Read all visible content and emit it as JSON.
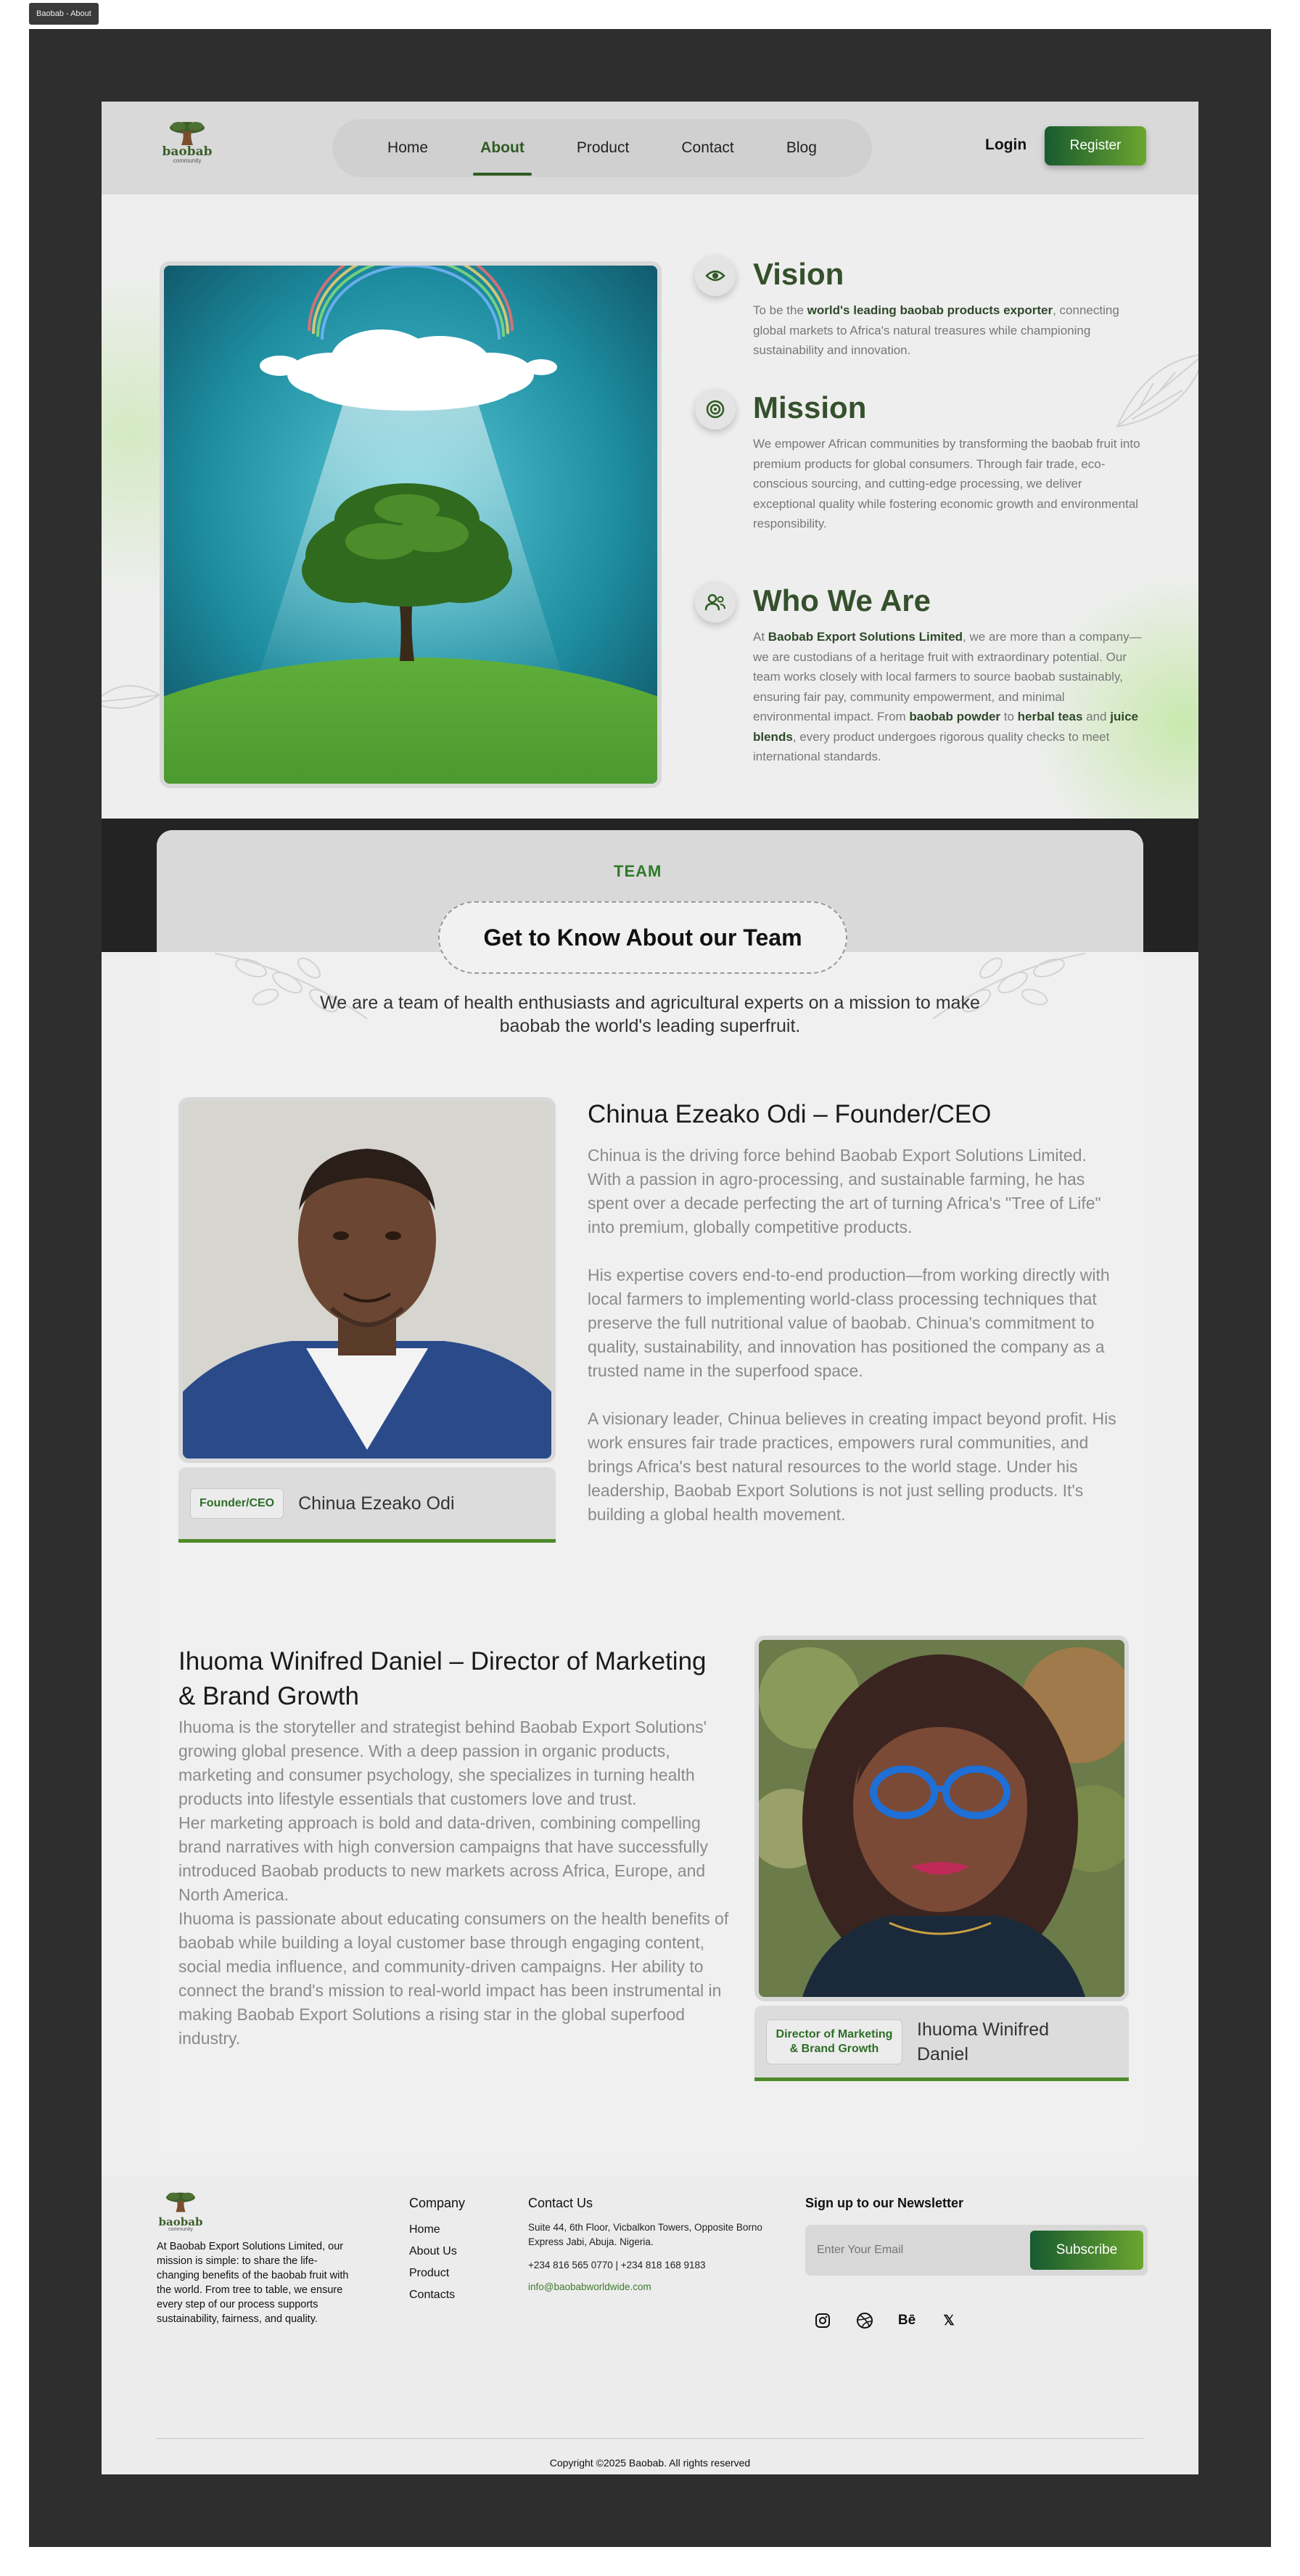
{
  "tab": {
    "title": "Baobab - About"
  },
  "brand": {
    "name": "baobab",
    "tagline": "community"
  },
  "nav": {
    "items": [
      "Home",
      "About",
      "Product",
      "Contact",
      "Blog"
    ],
    "active": "About",
    "login": "Login",
    "register": "Register"
  },
  "vision": {
    "title": "Vision",
    "pre": "To be the ",
    "bold": "world's leading baobab products exporter",
    "post": ", connecting global markets to Africa's natural treasures while championing sustainability and innovation."
  },
  "mission": {
    "title": "Mission",
    "text": "We empower African communities by transforming the baobab fruit into premium products for global consumers. Through fair trade, eco-conscious sourcing, and cutting-edge processing, we deliver exceptional quality while fostering economic growth and environmental responsibility."
  },
  "who": {
    "title": "Who We Are",
    "t1": "At ",
    "b1": "Baobab Export Solutions Limited",
    "t2": ", we are more than a company—we are custodians of a heritage fruit with extraordinary potential. Our team works closely with local farmers to source baobab sustainably, ensuring fair pay, community empowerment, and minimal environmental impact. From ",
    "b2": "baobab powder",
    "t3": " to ",
    "b3": "herbal teas",
    "t4": " and ",
    "b4": "juice blends",
    "t5": ", every product undergoes rigorous quality checks to meet international standards."
  },
  "team": {
    "tag": "TEAM",
    "title": "Get to Know About our Team",
    "subtitle": "We are a team of health enthusiasts and agricultural experts on a mission to make baobab the world's leading superfruit.",
    "members": [
      {
        "heading": "Chinua Ezeako Odi – Founder/CEO",
        "role": "Founder/CEO",
        "name": "Chinua Ezeako Odi",
        "paragraphs": [
          "Chinua is the driving force behind Baobab Export Solutions Limited. With a passion in agro-processing, and sustainable farming, he has spent over a decade perfecting the art of turning Africa's \"Tree of Life\" into premium, globally competitive products.",
          "His expertise covers end-to-end production—from working directly with local farmers to implementing world-class processing techniques that preserve the full nutritional value of baobab. Chinua's commitment to quality, sustainability, and innovation has positioned the company as a trusted name in the superfood space.",
          "A visionary leader, Chinua believes in creating impact beyond profit. His work ensures fair trade practices, empowers rural communities, and brings Africa's best natural resources to the world stage. Under his leadership, Baobab Export Solutions is not just selling products. It's building a global health movement."
        ]
      },
      {
        "heading": "Ihuoma Winifred Daniel – Director of Marketing & Brand Growth",
        "role": "Director of Marketing & Brand Growth",
        "name": "Ihuoma Winifred Daniel",
        "paragraphs": [
          "Ihuoma is the storyteller and strategist behind Baobab Export Solutions' growing global presence. With a deep passion in organic products, marketing and consumer psychology, she specializes in turning health products into lifestyle essentials that customers love and trust.",
          "Her marketing approach is bold and data-driven, combining compelling brand narratives with high conversion campaigns that have successfully introduced Baobab products to new markets across Africa, Europe, and North America.",
          "Ihuoma is passionate about educating consumers on the health benefits of baobab while building a loyal customer base through engaging content, social media influence, and community-driven campaigns. Her ability to connect the brand's mission to real-world impact has been instrumental in making Baobab Export Solutions a rising star in the global superfood industry."
        ]
      }
    ]
  },
  "footer": {
    "about": "At Baobab Export Solutions Limited, our mission is simple: to share the life-changing benefits of the baobab fruit with the world. From tree to table, we ensure every step of our process supports sustainability, fairness, and quality.",
    "company_heading": "Company",
    "company_links": [
      "Home",
      "About Us",
      "Product",
      "Contacts"
    ],
    "contact_heading": "Contact Us",
    "address": "Suite 44, 6th Floor, Vicbalkon Towers, Opposite Borno Express Jabi, Abuja. Nigeria.",
    "phones": "+234 816 565 0770 | +234 818 168 9183",
    "email": "info@baobabworldwide.com",
    "newsletter_heading": "Sign up to our Newsletter",
    "newsletter_placeholder": "Enter Your Email",
    "subscribe": "Subscribe",
    "social_icons": [
      "instagram-icon",
      "dribbble-icon",
      "behance-icon",
      "x-icon"
    ],
    "behance_text": "Bē",
    "x_text": "𝕏",
    "copyright": "Copyright ©2025  Baobab. All rights reserved"
  },
  "colors": {
    "brand_green": "#2f5b24",
    "button_gradient_start": "#175a2f",
    "button_gradient_end": "#6ca62f",
    "frame": "#2e2e2e"
  }
}
